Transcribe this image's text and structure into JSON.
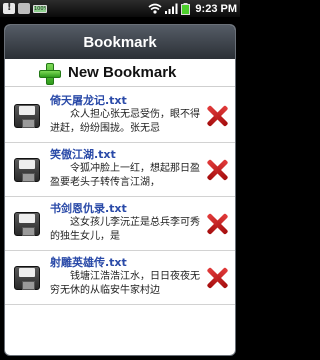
{
  "status_bar": {
    "battery_small_label": "100%",
    "time": "9:23 PM",
    "icons": [
      "alert-icon",
      "usb-icon",
      "battery-small-icon",
      "wifi-icon",
      "signal-icon",
      "battery-icon"
    ]
  },
  "dialog": {
    "title": "Bookmark",
    "new_bookmark_label": "New Bookmark"
  },
  "bookmarks": [
    {
      "title": "倚天屠龙记.txt",
      "preview": "众人担心张无忌受伤，眼不得进赶，纷纷围拢。张无忌"
    },
    {
      "title": "笑傲江湖.txt",
      "preview": "令狐冲脸上一红，想起那日盈盈要老头子转传言江湖，"
    },
    {
      "title": "书剑恩仇录.txt",
      "preview": "这女孩儿李沅芷是总兵李可秀的独生女儿，是"
    },
    {
      "title": "射雕英雄传.txt",
      "preview": "钱塘江浩浩江水，日日夜夜无穷无休的从临安牛家村边"
    }
  ]
}
